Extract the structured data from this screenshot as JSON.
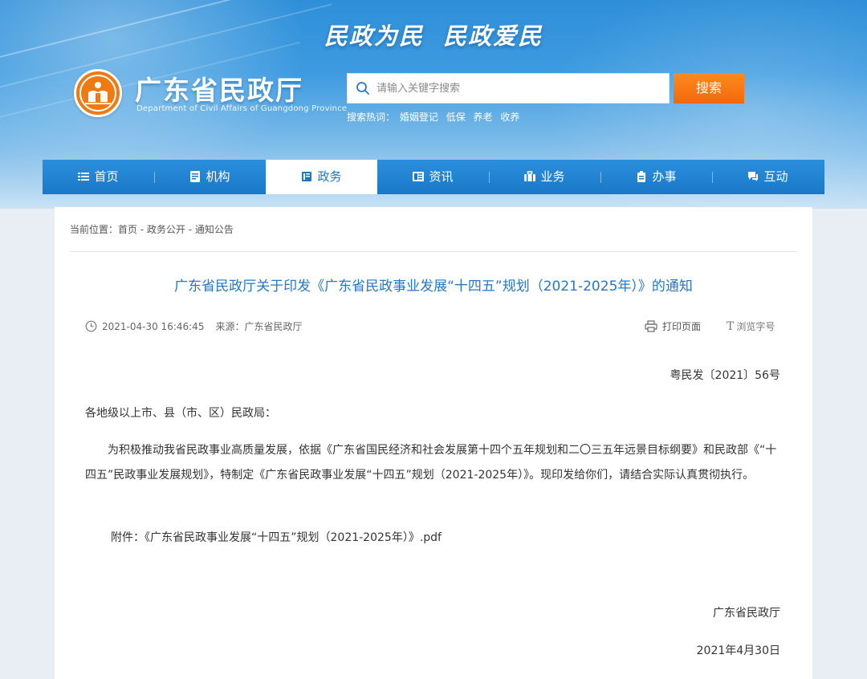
{
  "header": {
    "slogan": "民政为民  民政爱民",
    "site_name": "广东省民政厅",
    "site_name_en": "Department of Civil Affairs of Guangdong Province",
    "search_placeholder": "请输入关键字搜索",
    "search_button": "搜索",
    "hot_label": "搜索热词：",
    "hot_words": [
      "婚姻登记",
      "低保",
      "养老",
      "收养"
    ]
  },
  "nav": {
    "items": [
      {
        "label": "首页",
        "icon": "list-icon"
      },
      {
        "label": "机构",
        "icon": "document-icon"
      },
      {
        "label": "政务",
        "icon": "book-icon",
        "active": true
      },
      {
        "label": "资讯",
        "icon": "newspaper-icon"
      },
      {
        "label": "业务",
        "icon": "briefcase-icon"
      },
      {
        "label": "办事",
        "icon": "clipboard-icon"
      },
      {
        "label": "互动",
        "icon": "chat-icon"
      }
    ]
  },
  "breadcrumb": "当前位置：首页 - 政务公开 - 通知公告",
  "article": {
    "title": "广东省民政厅关于印发《广东省民政事业发展“十四五”规划（2021-2025年）》的通知",
    "datetime": "2021-04-30 16:46:45",
    "source": "来源：广东省民政厅",
    "print_label": "打印页面",
    "font_label": "浏览字号",
    "doc_number": "粤民发〔2021〕56号",
    "salutation": "各地级以上市、县（市、区）民政局：",
    "body": "为积极推动我省民政事业高质量发展，依据《广东省国民经济和社会发展第十四个五年规划和二〇三五年远景目标纲要》和民政部《“十四五”民政事业发展规划》，特制定《广东省民政事业发展“十四五”规划（2021-2025年）》。现印发给你们，请结合实际认真贯彻执行。",
    "attachment_label": "附件：",
    "attachment_link": "《广东省民政事业发展“十四五”规划（2021-2025年）》.pdf",
    "signature": "广东省民政厅",
    "date": "2021年4月30日"
  },
  "colors": {
    "nav_blue": "#1a78c9",
    "title_blue": "#2478c6",
    "search_orange": "#f2680a",
    "logo_orange": "#f07a12"
  }
}
